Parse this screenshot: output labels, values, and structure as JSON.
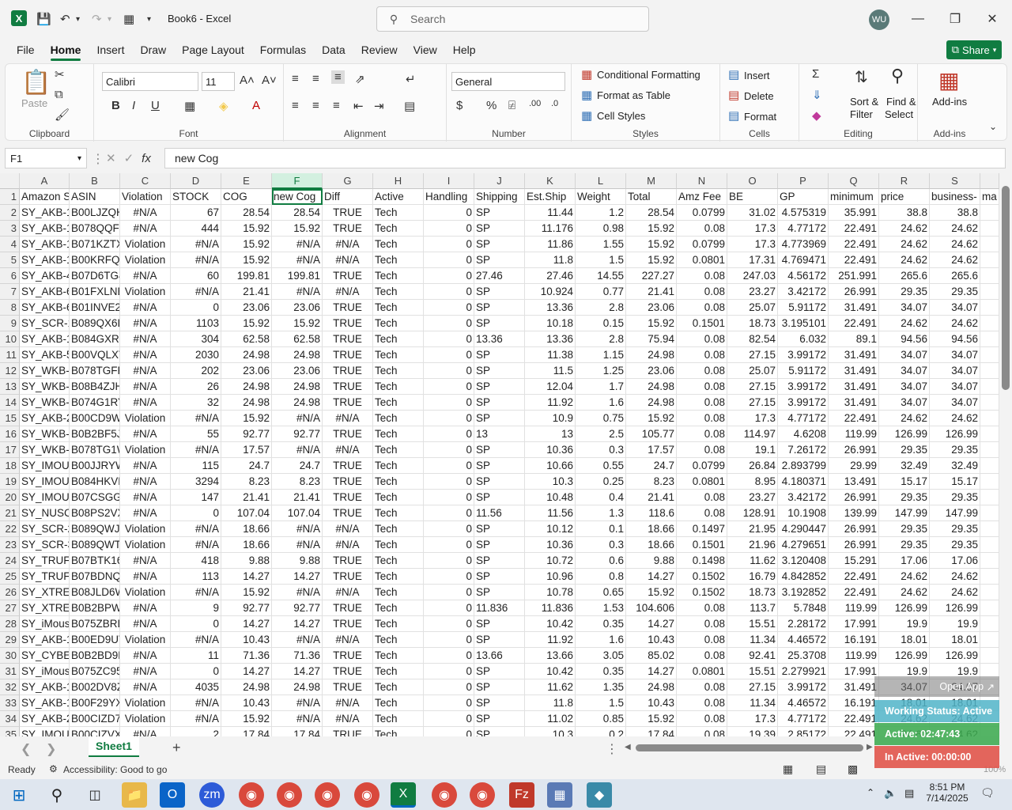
{
  "app": {
    "title": "Book6 - Excel",
    "search_placeholder": "Search",
    "user_initials": "WU"
  },
  "menu": [
    "File",
    "Home",
    "Insert",
    "Draw",
    "Page Layout",
    "Formulas",
    "Data",
    "Review",
    "View",
    "Help"
  ],
  "share_label": "Share",
  "ribbon": {
    "clipboard": {
      "label": "Clipboard",
      "paste": "Paste"
    },
    "font": {
      "label": "Font",
      "name": "Calibri",
      "size": "11"
    },
    "alignment": {
      "label": "Alignment"
    },
    "number": {
      "label": "Number",
      "format": "General"
    },
    "styles": {
      "label": "Styles",
      "conditional": "Conditional Formatting",
      "format_table": "Format as Table",
      "cell_styles": "Cell Styles"
    },
    "cells": {
      "label": "Cells",
      "insert": "Insert",
      "delete": "Delete",
      "format": "Format"
    },
    "editing": {
      "label": "Editing",
      "sort": "Sort &",
      "filter": "Filter",
      "find": "Find &",
      "select": "Select"
    },
    "addins": {
      "label": "Add-ins",
      "btn": "Add-ins"
    }
  },
  "formula": {
    "namebox": "F1",
    "value": "new Cog"
  },
  "columns": [
    "A",
    "B",
    "C",
    "D",
    "E",
    "F",
    "G",
    "H",
    "I",
    "J",
    "K",
    "L",
    "M",
    "N",
    "O",
    "P",
    "Q",
    "R",
    "S",
    ""
  ],
  "rows": [
    [
      "1",
      "Amazon S",
      "ASIN",
      "Violation",
      "STOCK",
      "COG",
      "new Cog",
      "Diff",
      "Active",
      "Handling",
      "Shipping",
      "Est.Ship",
      "Weight",
      "Total",
      "Amz Fee",
      "BE",
      "GP",
      "minimum",
      "price",
      "business-",
      "ma"
    ],
    [
      "2",
      "SY_AKB-1:",
      "B00LJZQHI",
      "#N/A",
      "67",
      "28.54",
      "28.54",
      "TRUE",
      "Tech",
      "0",
      "SP",
      "11.44",
      "1.2",
      "28.54",
      "0.0799",
      "31.02",
      "4.575319",
      "35.991",
      "38.8",
      "38.8",
      ""
    ],
    [
      "3",
      "SY_AKB-1:",
      "B078QQFC",
      "#N/A",
      "444",
      "15.92",
      "15.92",
      "TRUE",
      "Tech",
      "0",
      "SP",
      "11.176",
      "0.98",
      "15.92",
      "0.08",
      "17.3",
      "4.77172",
      "22.491",
      "24.62",
      "24.62",
      ""
    ],
    [
      "4",
      "SY_AKB-1:",
      "B071KZTX",
      "Violation",
      "#N/A",
      "15.92",
      "#N/A",
      "#N/A",
      "Tech",
      "0",
      "SP",
      "11.86",
      "1.55",
      "15.92",
      "0.0799",
      "17.3",
      "4.773969",
      "22.491",
      "24.62",
      "24.62",
      ""
    ],
    [
      "5",
      "SY_AKB-1:",
      "B00KRFQF",
      "Violation",
      "#N/A",
      "15.92",
      "#N/A",
      "#N/A",
      "Tech",
      "0",
      "SP",
      "11.8",
      "1.5",
      "15.92",
      "0.0801",
      "17.31",
      "4.769471",
      "22.491",
      "24.62",
      "24.62",
      ""
    ],
    [
      "6",
      "SY_AKB-4:",
      "B07D6TG4",
      "#N/A",
      "60",
      "199.81",
      "199.81",
      "TRUE",
      "Tech",
      "0",
      "27.46",
      "27.46",
      "14.55",
      "227.27",
      "0.08",
      "247.03",
      "4.56172",
      "251.991",
      "265.6",
      "265.6",
      ""
    ],
    [
      "7",
      "SY_AKB-6:",
      "B01FXLNE",
      "Violation",
      "#N/A",
      "21.41",
      "#N/A",
      "#N/A",
      "Tech",
      "0",
      "SP",
      "10.924",
      "0.77",
      "21.41",
      "0.08",
      "23.27",
      "3.42172",
      "26.991",
      "29.35",
      "29.35",
      ""
    ],
    [
      "8",
      "SY_AKB-6:",
      "B01INVE2",
      "#N/A",
      "0",
      "23.06",
      "23.06",
      "TRUE",
      "Tech",
      "0",
      "SP",
      "13.36",
      "2.8",
      "23.06",
      "0.08",
      "25.07",
      "5.91172",
      "31.491",
      "34.07",
      "34.07",
      ""
    ],
    [
      "9",
      "SY_SCR-1C",
      "B089QX6L",
      "#N/A",
      "1103",
      "15.92",
      "15.92",
      "TRUE",
      "Tech",
      "0",
      "SP",
      "10.18",
      "0.15",
      "15.92",
      "0.1501",
      "18.73",
      "3.195101",
      "22.491",
      "24.62",
      "24.62",
      ""
    ],
    [
      "10",
      "SY_AKB-1!",
      "B084GXRH",
      "#N/A",
      "304",
      "62.58",
      "62.58",
      "TRUE",
      "Tech",
      "0",
      "13.36",
      "13.36",
      "2.8",
      "75.94",
      "0.08",
      "82.54",
      "6.032",
      "89.1",
      "94.56",
      "94.56",
      ""
    ],
    [
      "11",
      "SY_AKB-5:",
      "B00VQLXT",
      "#N/A",
      "2030",
      "24.98",
      "24.98",
      "TRUE",
      "Tech",
      "0",
      "SP",
      "11.38",
      "1.15",
      "24.98",
      "0.08",
      "27.15",
      "3.99172",
      "31.491",
      "34.07",
      "34.07",
      ""
    ],
    [
      "12",
      "SY_WKB-1",
      "B078TGFP",
      "#N/A",
      "202",
      "23.06",
      "23.06",
      "TRUE",
      "Tech",
      "0",
      "SP",
      "11.5",
      "1.25",
      "23.06",
      "0.08",
      "25.07",
      "5.91172",
      "31.491",
      "34.07",
      "34.07",
      ""
    ],
    [
      "13",
      "SY_WKB-1",
      "B08B4ZJH:",
      "#N/A",
      "26",
      "24.98",
      "24.98",
      "TRUE",
      "Tech",
      "0",
      "SP",
      "12.04",
      "1.7",
      "24.98",
      "0.08",
      "27.15",
      "3.99172",
      "31.491",
      "34.07",
      "34.07",
      ""
    ],
    [
      "14",
      "SY_WKB-1",
      "B074G1RY.",
      "#N/A",
      "32",
      "24.98",
      "24.98",
      "TRUE",
      "Tech",
      "0",
      "SP",
      "11.92",
      "1.6",
      "24.98",
      "0.08",
      "27.15",
      "3.99172",
      "31.491",
      "34.07",
      "34.07",
      ""
    ],
    [
      "15",
      "SY_AKB-2:",
      "B00CD9W:",
      "Violation",
      "#N/A",
      "15.92",
      "#N/A",
      "#N/A",
      "Tech",
      "0",
      "SP",
      "10.9",
      "0.75",
      "15.92",
      "0.08",
      "17.3",
      "4.77172",
      "22.491",
      "24.62",
      "24.62",
      ""
    ],
    [
      "16",
      "SY_WKB-5",
      "B0B2BF5J(",
      "#N/A",
      "55",
      "92.77",
      "92.77",
      "TRUE",
      "Tech",
      "0",
      "13",
      "13",
      "2.5",
      "105.77",
      "0.08",
      "114.97",
      "4.6208",
      "119.99",
      "126.99",
      "126.99",
      ""
    ],
    [
      "17",
      "SY_WKB-6",
      "B078TG1W",
      "Violation",
      "#N/A",
      "17.57",
      "#N/A",
      "#N/A",
      "Tech",
      "0",
      "SP",
      "10.36",
      "0.3",
      "17.57",
      "0.08",
      "19.1",
      "7.26172",
      "26.991",
      "29.35",
      "29.35",
      ""
    ],
    [
      "18",
      "SY_IMOUS",
      "B00JJRYW",
      "#N/A",
      "115",
      "24.7",
      "24.7",
      "TRUE",
      "Tech",
      "0",
      "SP",
      "10.66",
      "0.55",
      "24.7",
      "0.0799",
      "26.84",
      "2.893799",
      "29.99",
      "32.49",
      "32.49",
      ""
    ],
    [
      "19",
      "SY_IMOUS",
      "B084HKVF",
      "#N/A",
      "3294",
      "8.23",
      "8.23",
      "TRUE",
      "Tech",
      "0",
      "SP",
      "10.3",
      "0.25",
      "8.23",
      "0.0801",
      "8.95",
      "4.180371",
      "13.491",
      "15.17",
      "15.17",
      ""
    ],
    [
      "20",
      "SY_IMOUS",
      "B07CSGGD",
      "#N/A",
      "147",
      "21.41",
      "21.41",
      "TRUE",
      "Tech",
      "0",
      "SP",
      "10.48",
      "0.4",
      "21.41",
      "0.08",
      "23.27",
      "3.42172",
      "26.991",
      "29.35",
      "29.35",
      ""
    ],
    [
      "21",
      "SY_NUSCA",
      "B08PS2VX",
      "#N/A",
      "0",
      "107.04",
      "107.04",
      "TRUE",
      "Tech",
      "0",
      "11.56",
      "11.56",
      "1.3",
      "118.6",
      "0.08",
      "128.91",
      "10.1908",
      "139.99",
      "147.99",
      "147.99",
      ""
    ],
    [
      "22",
      "SY_SCR-2C",
      "B089QWJI",
      "Violation",
      "#N/A",
      "18.66",
      "#N/A",
      "#N/A",
      "Tech",
      "0",
      "SP",
      "10.12",
      "0.1",
      "18.66",
      "0.1497",
      "21.95",
      "4.290447",
      "26.991",
      "29.35",
      "29.35",
      ""
    ],
    [
      "23",
      "SY_SCR-3C",
      "B089QWTI",
      "Violation",
      "#N/A",
      "18.66",
      "#N/A",
      "#N/A",
      "Tech",
      "0",
      "SP",
      "10.36",
      "0.3",
      "18.66",
      "0.1501",
      "21.96",
      "4.279651",
      "26.991",
      "29.35",
      "29.35",
      ""
    ],
    [
      "24",
      "SY_TRUFO",
      "B07BTK16",
      "#N/A",
      "418",
      "9.88",
      "9.88",
      "TRUE",
      "Tech",
      "0",
      "SP",
      "10.72",
      "0.6",
      "9.88",
      "0.1498",
      "11.62",
      "3.120408",
      "15.291",
      "17.06",
      "17.06",
      ""
    ],
    [
      "25",
      "SY_TRUFO",
      "B07BDNQ!",
      "#N/A",
      "113",
      "14.27",
      "14.27",
      "TRUE",
      "Tech",
      "0",
      "SP",
      "10.96",
      "0.8",
      "14.27",
      "0.1502",
      "16.79",
      "4.842852",
      "22.491",
      "24.62",
      "24.62",
      ""
    ],
    [
      "26",
      "SY_XTREA",
      "B08JLD6W",
      "Violation",
      "#N/A",
      "15.92",
      "#N/A",
      "#N/A",
      "Tech",
      "0",
      "SP",
      "10.78",
      "0.65",
      "15.92",
      "0.1502",
      "18.73",
      "3.192852",
      "22.491",
      "24.62",
      "24.62",
      ""
    ],
    [
      "27",
      "SY_XTREA",
      "B0B2BPWI",
      "#N/A",
      "9",
      "92.77",
      "92.77",
      "TRUE",
      "Tech",
      "0",
      "11.836",
      "11.836",
      "1.53",
      "104.606",
      "0.08",
      "113.7",
      "5.7848",
      "119.99",
      "126.99",
      "126.99",
      ""
    ],
    [
      "28",
      "SY_iMous",
      "B075ZBRD",
      "#N/A",
      "0",
      "14.27",
      "14.27",
      "TRUE",
      "Tech",
      "0",
      "SP",
      "10.42",
      "0.35",
      "14.27",
      "0.08",
      "15.51",
      "2.28172",
      "17.991",
      "19.9",
      "19.9",
      ""
    ],
    [
      "29",
      "SY_AKB-1:",
      "B00ED9UT",
      "Violation",
      "#N/A",
      "10.43",
      "#N/A",
      "#N/A",
      "Tech",
      "0",
      "SP",
      "11.92",
      "1.6",
      "10.43",
      "0.08",
      "11.34",
      "4.46572",
      "16.191",
      "18.01",
      "18.01",
      ""
    ],
    [
      "30",
      "SY_CYBER",
      "B0B2BD9F",
      "#N/A",
      "11",
      "71.36",
      "71.36",
      "TRUE",
      "Tech",
      "0",
      "13.66",
      "13.66",
      "3.05",
      "85.02",
      "0.08",
      "92.41",
      "25.3708",
      "119.99",
      "126.99",
      "126.99",
      ""
    ],
    [
      "31",
      "SY_iMous",
      "B075ZC95:",
      "#N/A",
      "0",
      "14.27",
      "14.27",
      "TRUE",
      "Tech",
      "0",
      "SP",
      "10.42",
      "0.35",
      "14.27",
      "0.0801",
      "15.51",
      "2.279921",
      "17.991",
      "19.9",
      "19.9",
      ""
    ],
    [
      "32",
      "SY_AKB-1:",
      "B002DV8Z",
      "#N/A",
      "4035",
      "24.98",
      "24.98",
      "TRUE",
      "Tech",
      "0",
      "SP",
      "11.62",
      "1.35",
      "24.98",
      "0.08",
      "27.15",
      "3.99172",
      "31.491",
      "34.07",
      "34.07",
      ""
    ],
    [
      "33",
      "SY_AKB-1:",
      "B00F29YX:",
      "Violation",
      "#N/A",
      "10.43",
      "#N/A",
      "#N/A",
      "Tech",
      "0",
      "SP",
      "11.8",
      "1.5",
      "10.43",
      "0.08",
      "11.34",
      "4.46572",
      "16.191",
      "18.01",
      "18.01",
      ""
    ],
    [
      "34",
      "SY_AKB-2:",
      "B00CIZD7I",
      "Violation",
      "#N/A",
      "15.92",
      "#N/A",
      "#N/A",
      "Tech",
      "0",
      "SP",
      "11.02",
      "0.85",
      "15.92",
      "0.08",
      "17.3",
      "4.77172",
      "22.491",
      "24.62",
      "24.62",
      ""
    ],
    [
      "35",
      "SY_IMOUS",
      "B00CIZVXS",
      "#N/A",
      "2",
      "17.84",
      "17.84",
      "TRUE",
      "Tech",
      "0",
      "SP",
      "10.3",
      "0.2",
      "17.84",
      "0.08",
      "19.39",
      "2.85172",
      "22.491",
      "24.62",
      "24.62",
      ""
    ]
  ],
  "sheet_tab": "Sheet1",
  "status": {
    "ready": "Ready",
    "accessibility": "Accessibility: Good to go",
    "zoom": "100%"
  },
  "overlay": {
    "open_app": "Open App",
    "working": "Working Status: Active",
    "active": "Active: 02:47:43",
    "inactive": "In Active: 00:00:00"
  },
  "clock": {
    "time": "8:51 PM",
    "date": "7/14/2025"
  }
}
